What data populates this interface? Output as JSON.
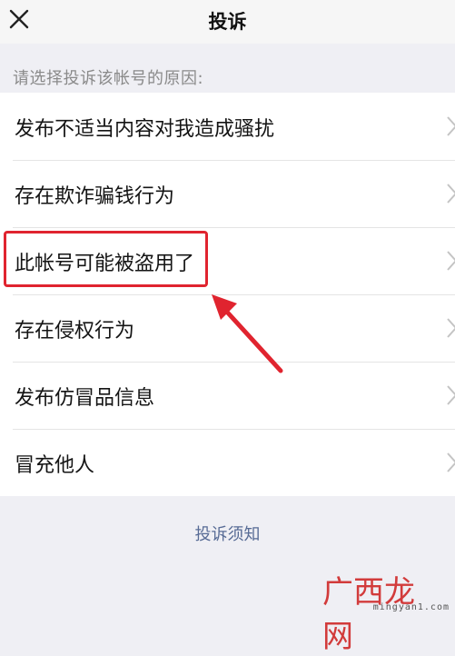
{
  "header": {
    "title": "投诉",
    "close_icon": "close-icon"
  },
  "subtitle": "请选择投诉该帐号的原因:",
  "reasons": [
    {
      "label": "发布不适当内容对我造成骚扰"
    },
    {
      "label": "存在欺诈骗钱行为"
    },
    {
      "label": "此帐号可能被盗用了"
    },
    {
      "label": "存在侵权行为"
    },
    {
      "label": "发布仿冒品信息"
    },
    {
      "label": "冒充他人"
    }
  ],
  "footer": {
    "notice_link": "投诉须知"
  },
  "annotation": {
    "highlight_color": "#e0242f",
    "highlighted_item": "此帐号可能被盗用了"
  },
  "watermark": {
    "text": "广西龙网",
    "url": "mingyan1.com"
  },
  "colors": {
    "background": "#efeff4",
    "link": "#576b95",
    "highlight": "#e0242f"
  }
}
